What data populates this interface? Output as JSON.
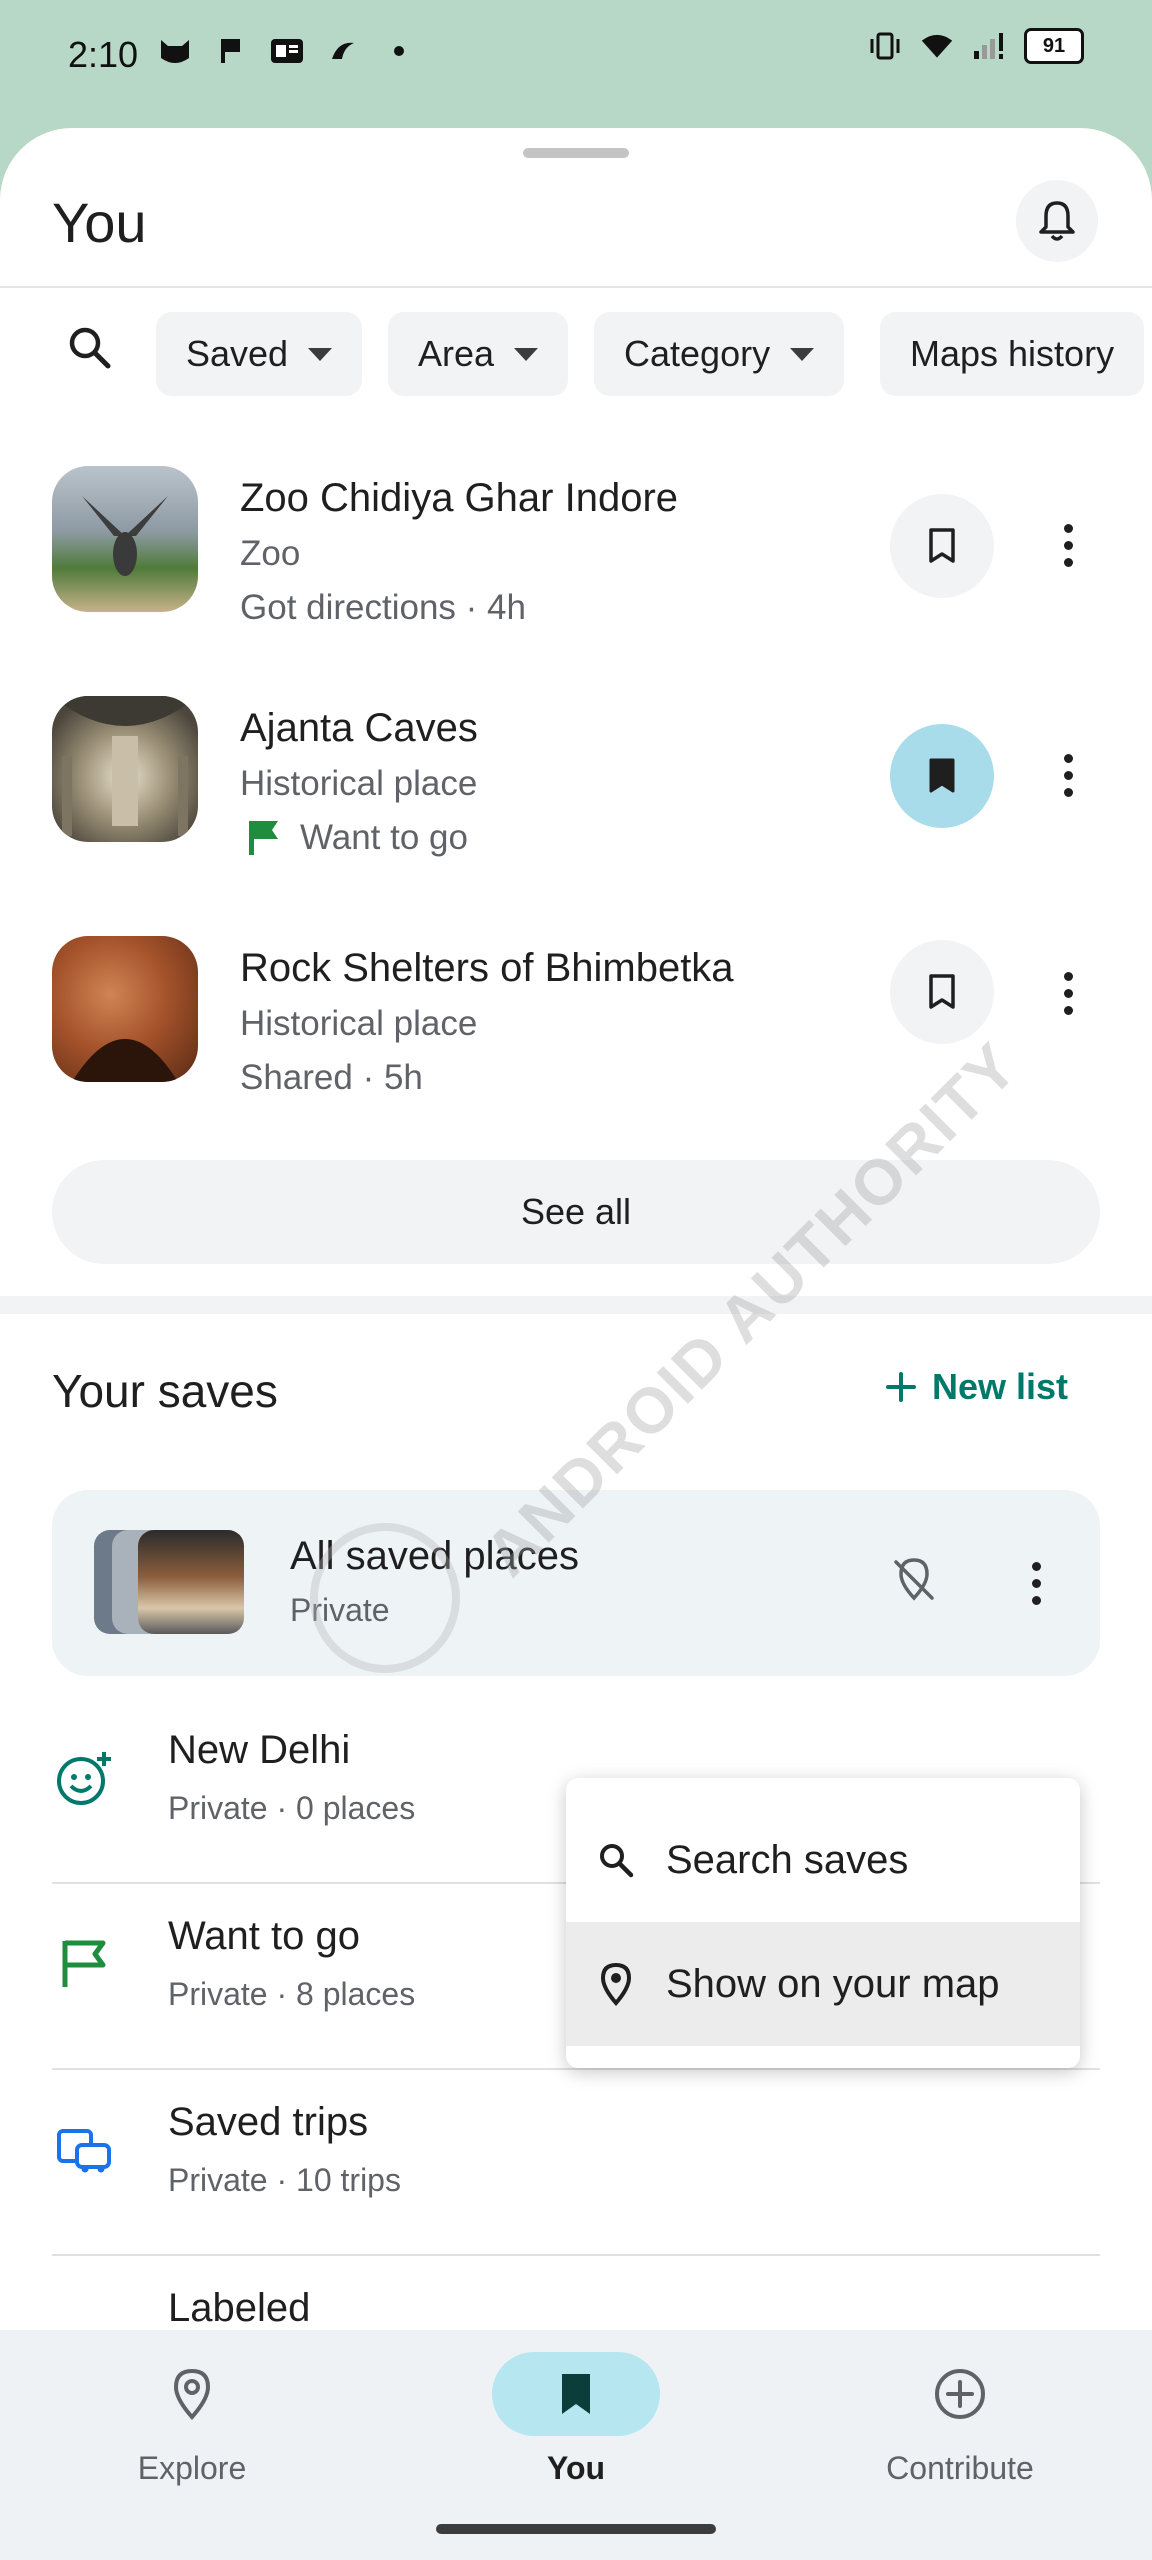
{
  "status_bar": {
    "time": "2:10",
    "battery": "91"
  },
  "header": {
    "title": "You"
  },
  "filters": {
    "chips": [
      {
        "label": "Saved"
      },
      {
        "label": "Area"
      },
      {
        "label": "Category"
      },
      {
        "label": "Maps history"
      }
    ]
  },
  "places": [
    {
      "name": "Zoo Chidiya Ghar Indore",
      "type": "Zoo",
      "meta": "Got directions · 4h",
      "saved": false
    },
    {
      "name": "Ajanta Caves",
      "type": "Historical place",
      "meta": "Want to go",
      "saved": true
    },
    {
      "name": "Rock Shelters of Bhimbetka",
      "type": "Historical place",
      "meta": "Shared · 5h",
      "saved": false
    }
  ],
  "see_all": "See all",
  "saves": {
    "title": "Your saves",
    "new_list": "New list",
    "all_saved": {
      "name": "All saved places",
      "sub": "Private"
    },
    "lists": [
      {
        "name": "New Delhi",
        "sub": "Private · 0 places",
        "icon": "emoji-add-icon"
      },
      {
        "name": "Want to go",
        "sub": "Private · 8 places",
        "icon": "flag-icon"
      },
      {
        "name": "Saved trips",
        "sub": "Private · 10 trips",
        "icon": "trips-icon"
      },
      {
        "name": "Labeled",
        "sub": "",
        "icon": "label-icon"
      }
    ]
  },
  "menu": {
    "items": [
      {
        "label": "Search saves",
        "icon": "search-icon"
      },
      {
        "label": "Show on your map",
        "icon": "location-pin-icon"
      }
    ]
  },
  "bottom_nav": {
    "items": [
      {
        "label": "Explore"
      },
      {
        "label": "You"
      },
      {
        "label": "Contribute"
      }
    ]
  },
  "watermark": "ANDROID AUTHORITY",
  "colors": {
    "accent": "#00796b",
    "saved_active": "#a8dcea",
    "nav_active": "#b6e6f0",
    "flag": "#1e8e3e"
  }
}
